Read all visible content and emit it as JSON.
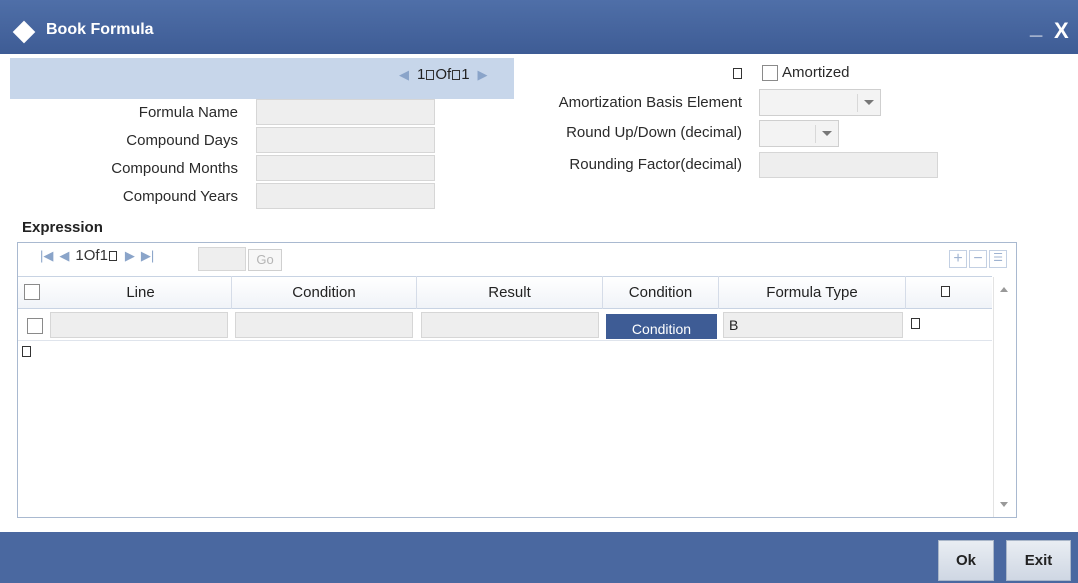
{
  "window": {
    "title": "Book Formula",
    "minimize_label": "_",
    "close_label": "X"
  },
  "record_nav": {
    "current": "1",
    "of_label": "Of",
    "total": "1"
  },
  "form": {
    "formula_name_label": "Formula Name",
    "compound_days_label": "Compound Days",
    "compound_months_label": "Compound Months",
    "compound_years_label": "Compound Years",
    "amortized_label": "Amortized",
    "amortization_basis_label": "Amortization Basis Element",
    "round_updown_label": "Round Up/Down (decimal)",
    "rounding_factor_label": "Rounding Factor(decimal)"
  },
  "expression": {
    "section_title": "Expression",
    "pager": {
      "current": "1",
      "of_label": "Of",
      "total": "1",
      "go_label": "Go"
    },
    "columns": [
      "Line",
      "Condition",
      "Result",
      "Condition",
      "Formula Type"
    ],
    "rows": [
      {
        "line": "",
        "condition": "",
        "result": "",
        "condition_button": "Condition",
        "formula_type": "B"
      }
    ]
  },
  "footer": {
    "ok_label": "Ok",
    "exit_label": "Exit"
  },
  "colors": {
    "titlebar": "#3e5c95",
    "record_band": "#c7d6ea",
    "footer": "#4a68a0",
    "condition_button": "#3e5c95"
  }
}
